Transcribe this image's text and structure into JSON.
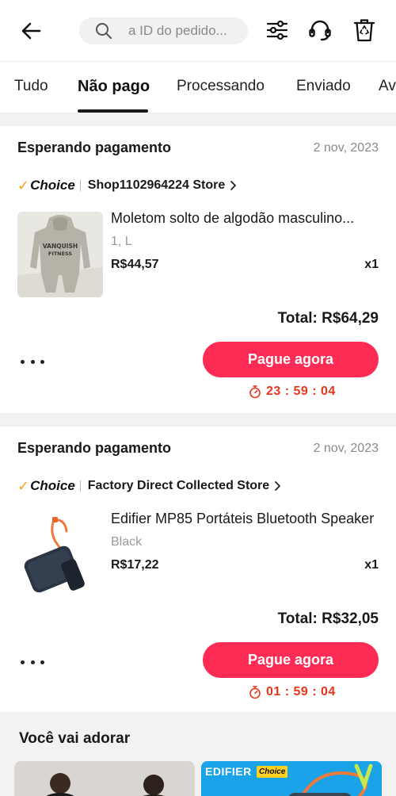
{
  "search": {
    "placeholder": "a ID do pedido..."
  },
  "icons": {
    "back": "arrow-left-icon",
    "filter": "sliders-icon",
    "support": "headset-icon",
    "recycle": "recycle-bin-icon",
    "search": "search-icon",
    "timer": "stopwatch-icon"
  },
  "tabs": [
    {
      "label": "Tudo",
      "active": false
    },
    {
      "label": "Não pago",
      "active": true
    },
    {
      "label": "Processando",
      "active": false
    },
    {
      "label": "Enviado",
      "active": false
    },
    {
      "label": "Av",
      "active": false
    }
  ],
  "choice_label": "Choice",
  "orders": [
    {
      "status": "Esperando pagamento",
      "date": "2 nov, 2023",
      "store": "Shop1102964224 Store",
      "product": {
        "title": "Moletom solto de algodão masculino...",
        "variant": "1, L",
        "price": "R$44,57",
        "qty": "x1",
        "image_text": "VANQUISH FITNESS"
      },
      "total": "Total: R$64,29",
      "pay_label": "Pague agora",
      "countdown": "23 : 59 : 04"
    },
    {
      "status": "Esperando pagamento",
      "date": "2 nov, 2023",
      "store": "Factory Direct Collected Store",
      "product": {
        "title": "Edifier MP85 Portáteis Bluetooth Speaker",
        "variant": "Black",
        "price": "R$17,22",
        "qty": "x1"
      },
      "total": "Total: R$32,05",
      "pay_label": "Pague agora",
      "countdown": "01 : 59 : 04"
    }
  ],
  "recommendations": {
    "title": "Você vai adorar",
    "items": [
      {
        "brand": ""
      },
      {
        "brand": "EDIFIER",
        "badge": "Choice"
      }
    ]
  },
  "colors": {
    "accent": "#fe2c55",
    "timer": "#e8361b",
    "choice_check": "#f7a21b"
  }
}
